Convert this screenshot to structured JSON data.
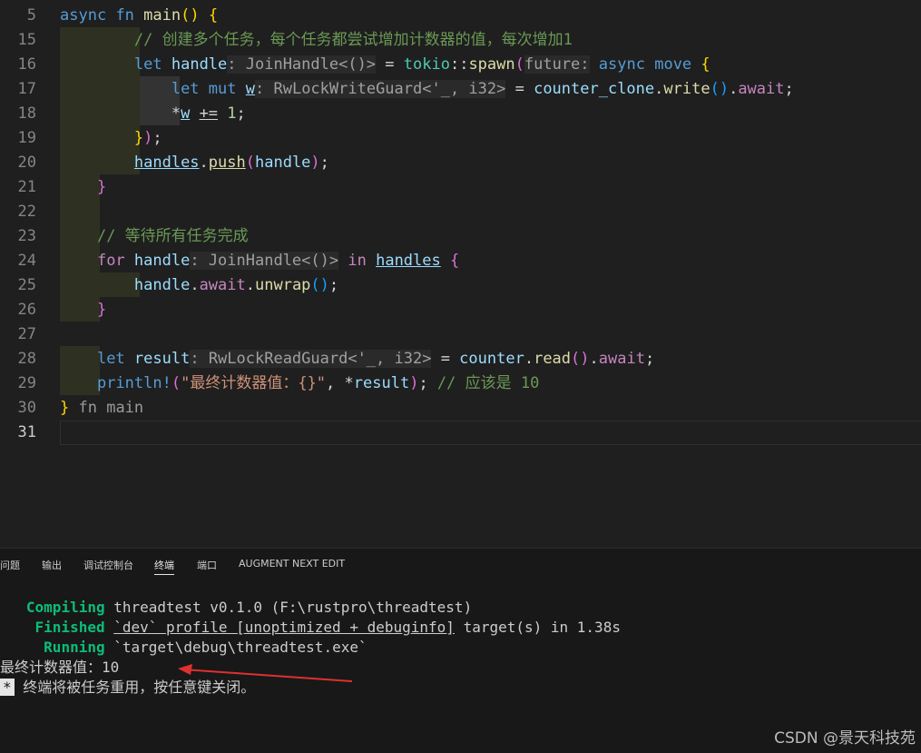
{
  "editor": {
    "lines": [
      {
        "num": "5"
      },
      {
        "num": "15",
        "comment": "// 创建多个任务，每个任务都尝试增加计数器的值，每次增加1"
      },
      {
        "num": "16"
      },
      {
        "num": "17"
      },
      {
        "num": "18"
      },
      {
        "num": "19"
      },
      {
        "num": "20"
      },
      {
        "num": "21"
      },
      {
        "num": "22"
      },
      {
        "num": "23",
        "comment": "// 等待所有任务完成"
      },
      {
        "num": "24"
      },
      {
        "num": "25"
      },
      {
        "num": "26"
      },
      {
        "num": "27"
      },
      {
        "num": "28"
      },
      {
        "num": "29",
        "string": "\"最终计数器值：{}\"",
        "comment": "// 应该是 10"
      },
      {
        "num": "30",
        "fold_label": "fn main"
      },
      {
        "num": "31"
      }
    ]
  },
  "panel": {
    "tabs": [
      "问题",
      "输出",
      "调试控制台",
      "终端",
      "端口",
      "AUGMENT NEXT EDIT"
    ],
    "active_tab": "终端",
    "terminal": {
      "compiling_label": "Compiling",
      "compiling_text": "threadtest v0.1.0 (F:\\rustpro\\threadtest)",
      "finished_label": "Finished",
      "finished_profile": "`dev` profile [unoptimized + debuginfo]",
      "finished_rest": "target(s) in 1.38s",
      "running_label": "Running",
      "running_text": "`target\\debug\\threadtest.exe`",
      "output_line": "最终计数器值：10",
      "star": "*",
      "reuse_msg": "终端将被任务重用，按任意键关闭。"
    }
  },
  "watermark": "CSDN @景天科技苑",
  "colors": {
    "background": "#1f1f1f",
    "panel": "#181818",
    "annotation_arrow": "#e03030",
    "terminal_green": "#0dbc79"
  }
}
